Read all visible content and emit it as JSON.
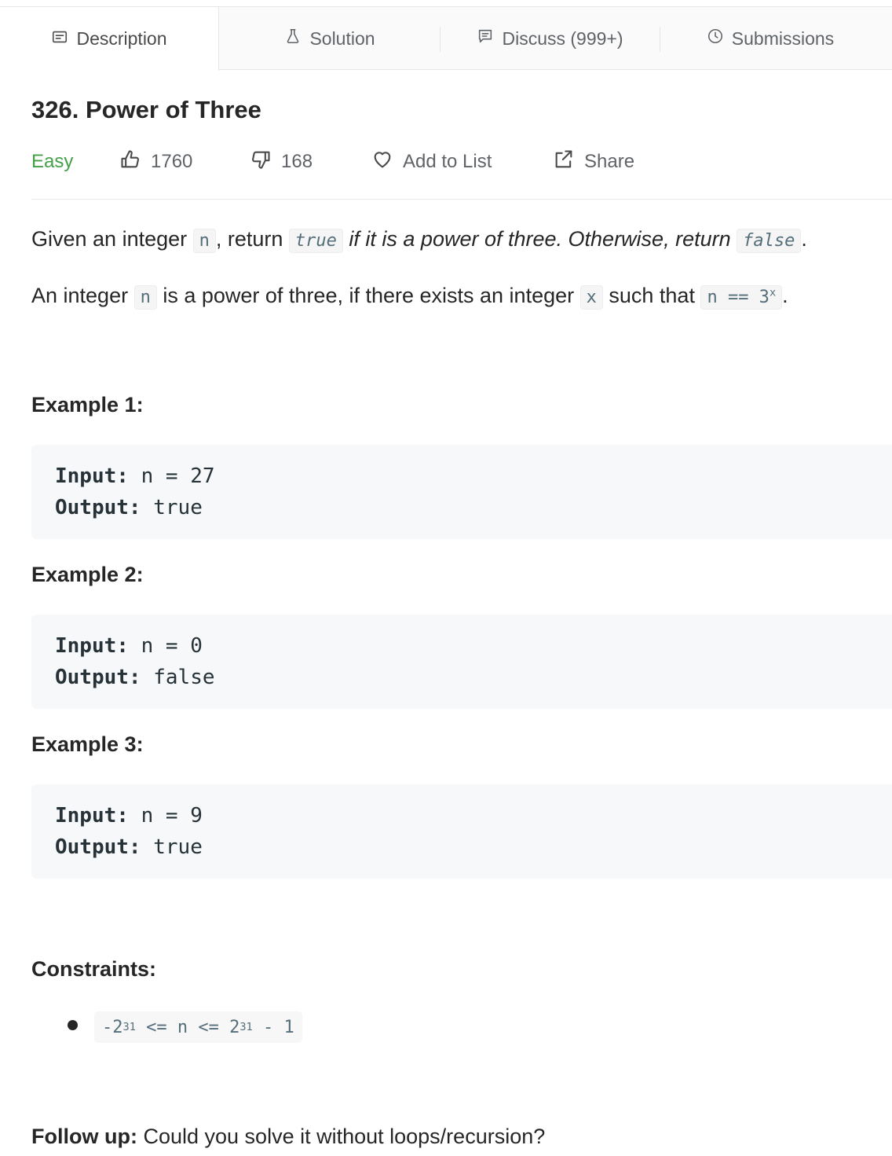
{
  "tabs": [
    {
      "label": "Description",
      "icon": "document-icon",
      "active": true
    },
    {
      "label": "Solution",
      "icon": "flask-icon",
      "active": false
    },
    {
      "label": "Discuss (999+)",
      "icon": "comment-icon",
      "active": false
    },
    {
      "label": "Submissions",
      "icon": "clock-icon",
      "active": false
    }
  ],
  "problem": {
    "title": "326. Power of Three",
    "difficulty": "Easy",
    "difficulty_color": "#43a047",
    "likes": "1760",
    "dislikes": "168",
    "add_to_list": "Add to List",
    "share": "Share"
  },
  "description": {
    "p1": {
      "t1": "Given an integer ",
      "c1": "n",
      "t2": ", return ",
      "c2": "true",
      "t3": " if it is a power of three. Otherwise, return ",
      "c3": "false",
      "t4": "."
    },
    "p2": {
      "t1": "An integer ",
      "c1": "n",
      "t2": " is a power of three, if there exists an integer ",
      "c2": "x",
      "t3": " such that ",
      "c3_base": "n == 3",
      "c3_sup": "x",
      "t4": "."
    }
  },
  "examples": [
    {
      "heading": "Example 1:",
      "input_label": "Input:",
      "input": " n = 27",
      "output_label": "Output:",
      "output": " true"
    },
    {
      "heading": "Example 2:",
      "input_label": "Input:",
      "input": " n = 0",
      "output_label": "Output:",
      "output": " false"
    },
    {
      "heading": "Example 3:",
      "input_label": "Input:",
      "input": " n = 9",
      "output_label": "Output:",
      "output": " true"
    }
  ],
  "constraints": {
    "heading": "Constraints:",
    "item": {
      "a": "-2",
      "sup1": "31",
      "b": " <= n <= 2",
      "sup2": "31",
      "c": " - 1"
    }
  },
  "followup": {
    "label": "Follow up:",
    "text": " Could you solve it without loops/recursion?"
  }
}
